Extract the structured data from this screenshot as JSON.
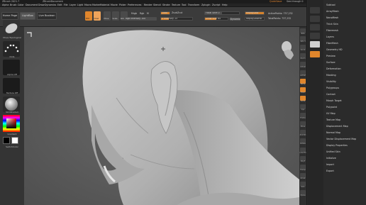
{
  "title_bar": {
    "app": "ZBrush 2021.7",
    "document": "ZBrushDocument",
    "quicksave": "QuickSave",
    "see_through": "See-through 0",
    "menus": "Menus",
    "script": "DefaultZScript"
  },
  "menu_bar": [
    "Alpha",
    "Brush",
    "Color",
    "Document",
    "Draw",
    "Dynamics",
    "Edit",
    "File",
    "Layer",
    "Light",
    "Macro",
    "Marker",
    "Material",
    "Movie",
    "Picker",
    "Preferences",
    "Render",
    "Stencil",
    "Stroke",
    "Texture",
    "Tool",
    "Transform",
    "Zplugin",
    "Zscript",
    "Help"
  ],
  "shelf": {
    "home_page": "Home Page",
    "lightbox": "LightBox",
    "live_boolean": "Live Boolean",
    "edit": "Edit",
    "draw": "Draw",
    "move": "Move",
    "scale": "Scale",
    "rotate": "Rotate",
    "mrgb": "Mrgb",
    "rgb": "Rgb",
    "m": "M",
    "zadd": "Zadd",
    "zsub": "Zsub",
    "zcut": "Zcut",
    "rgb_intensity": "Rgb Intensity 100",
    "z_intensity": "Z Intensity 25",
    "focal_shift": "Focal Shift 0",
    "draw_size": "Draw Size 64",
    "dynamic": "Dynamic",
    "active_points": "ActivePoints: 737,232",
    "total_points": "TotalPoints: 737,232",
    "replay_last": "ReplayLast",
    "replay_last_rel": "ReplayLastRel"
  },
  "left_tray": {
    "brush_label": "Move Topological",
    "stroke_label": "Dots",
    "alpha_label": "Alpha Off",
    "texture_label": "Texture Off",
    "material_label": "SkinShade4",
    "gradient_label": "Gradient",
    "switch_label": "SwitchColor"
  },
  "right_col": [
    "BPR",
    "SPix 3",
    "Scroll",
    "Zoom",
    "Actual",
    "AAHalf",
    "Persp",
    "Floor",
    "Local",
    "Gyz",
    "Frame",
    "Move",
    "ZoomD",
    "Rotate",
    "Line Fill",
    "PolyF",
    "Transp",
    "Ghost",
    "Solo",
    "Xpose"
  ],
  "palette": {
    "items": [
      "Subtool",
      "ArrayMesh",
      "NanoMesh",
      "Thick Skin",
      "Fibermesh",
      "Layers",
      "FiberMesh",
      "Geometry HD",
      "Preview",
      "Surface",
      "Deformation",
      "Masking",
      "Visibility",
      "Polygroups",
      "Contact",
      "Morph Target",
      "Polypaint",
      "UV Map",
      "Texture Map",
      "Displacement Map",
      "Normal Map",
      "Vector Displacement Map",
      "Display Properties",
      "Unified Skin",
      "Initialize",
      "Import",
      "Export"
    ]
  },
  "colors": {
    "accent": "#e0862c",
    "viewport_bg": "#5f5f5f",
    "mesh": "#b9b9b9"
  }
}
